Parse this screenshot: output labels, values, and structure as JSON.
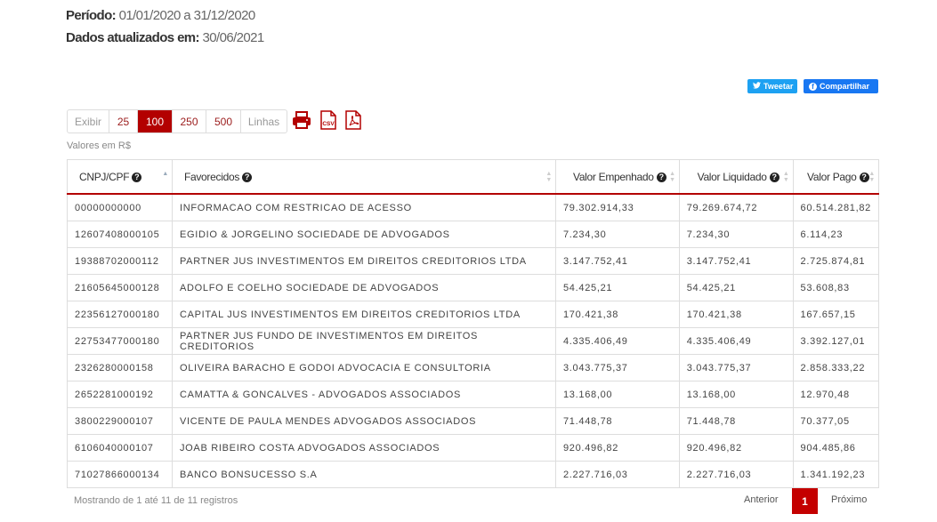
{
  "header": {
    "period_label": "Período:",
    "period_value": "01/01/2020 a 31/12/2020",
    "updated_label": "Dados atualizados em:",
    "updated_value": "30/06/2021"
  },
  "share": {
    "tweet_label": "Tweetar",
    "share_label": "Compartilhar"
  },
  "length_menu": {
    "prefix": "Exibir",
    "options": [
      "25",
      "100",
      "250",
      "500"
    ],
    "selected": "100",
    "suffix": "Linhas"
  },
  "export": {
    "csv_text": "CSV"
  },
  "currency_note": "Valores em R$",
  "table": {
    "columns": [
      "CNPJ/CPF",
      "Favorecidos",
      "Valor Empenhado",
      "Valor Liquidado",
      "Valor Pago"
    ],
    "rows": [
      [
        "00000000000",
        "INFORMACAO COM RESTRICAO DE ACESSO",
        "79.302.914,33",
        "79.269.674,72",
        "60.514.281,82"
      ],
      [
        "12607408000105",
        "EGIDIO & JORGELINO SOCIEDADE DE ADVOGADOS",
        "7.234,30",
        "7.234,30",
        "6.114,23"
      ],
      [
        "19388702000112",
        "PARTNER JUS INVESTIMENTOS EM DIREITOS CREDITORIOS LTDA",
        "3.147.752,41",
        "3.147.752,41",
        "2.725.874,81"
      ],
      [
        "21605645000128",
        "ADOLFO E COELHO SOCIEDADE DE ADVOGADOS",
        "54.425,21",
        "54.425,21",
        "53.608,83"
      ],
      [
        "22356127000180",
        "CAPITAL JUS INVESTIMENTOS EM DIREITOS CREDITORIOS LTDA",
        "170.421,38",
        "170.421,38",
        "167.657,15"
      ],
      [
        "22753477000180",
        "PARTNER JUS FUNDO DE INVESTIMENTOS EM DIREITOS CREDITORIOS",
        "4.335.406,49",
        "4.335.406,49",
        "3.392.127,01"
      ],
      [
        "2326280000158",
        "OLIVEIRA BARACHO E GODOI ADVOCACIA E CONSULTORIA",
        "3.043.775,37",
        "3.043.775,37",
        "2.858.333,22"
      ],
      [
        "2652281000192",
        "CAMATTA & GONCALVES - ADVOGADOS ASSOCIADOS",
        "13.168,00",
        "13.168,00",
        "12.970,48"
      ],
      [
        "3800229000107",
        "VICENTE DE PAULA MENDES ADVOGADOS ASSOCIADOS",
        "71.448,78",
        "71.448,78",
        "70.377,05"
      ],
      [
        "6106040000107",
        "JOAB RIBEIRO COSTA ADVOGADOS ASSOCIADOS",
        "920.496,82",
        "920.496,82",
        "904.485,86"
      ],
      [
        "71027866000134",
        "BANCO BONSUCESSO S.A",
        "2.227.716,03",
        "2.227.716,03",
        "1.341.192,23"
      ]
    ]
  },
  "footer": {
    "info": "Mostrando de 1 até 11 de 11 registros",
    "prev_label": "Anterior",
    "current_page": "1",
    "next_label": "Próximo"
  },
  "colors": {
    "accent": "#b30000",
    "twitter": "#1da1f2",
    "facebook": "#1877f2"
  },
  "icons": [
    "twitter-icon",
    "facebook-icon",
    "print-icon",
    "csv-icon",
    "pdf-icon",
    "help-icon",
    "sort-icon"
  ]
}
